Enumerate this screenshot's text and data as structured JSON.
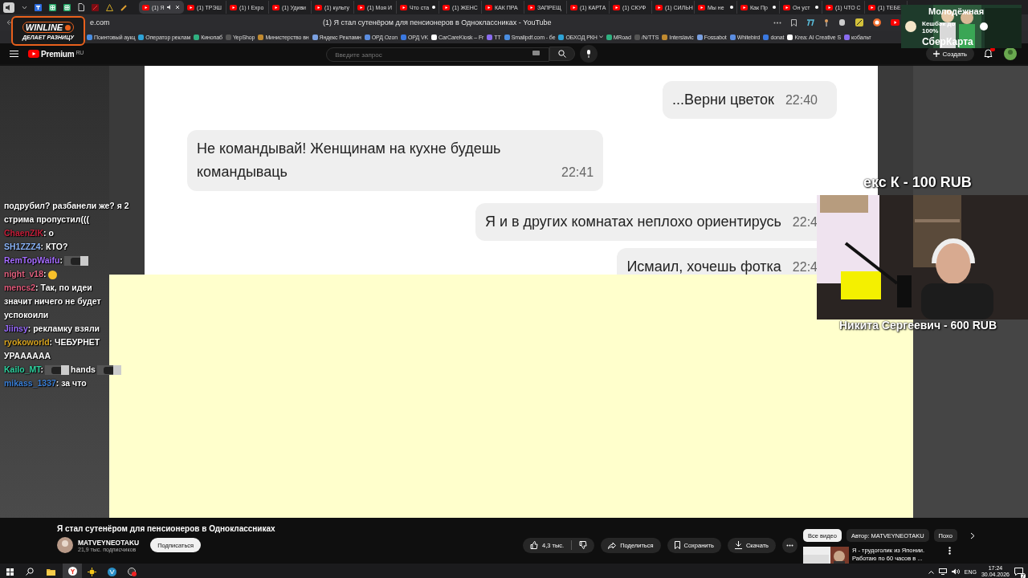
{
  "browser": {
    "tabs": [
      {
        "title": "(1) Я",
        "selected": true,
        "unread": false
      },
      {
        "title": "(1) ТРЭШ",
        "selected": false,
        "unread": false
      },
      {
        "title": "(1) I Expo",
        "selected": false,
        "unread": false
      },
      {
        "title": "(1) Удиви",
        "selected": false,
        "unread": false
      },
      {
        "title": "(1) культу",
        "selected": false,
        "unread": false
      },
      {
        "title": "(1) Моя И",
        "selected": false,
        "unread": false
      },
      {
        "title": "Что ста",
        "selected": false,
        "unread": true
      },
      {
        "title": "(1) ЖЕНС",
        "selected": false,
        "unread": false
      },
      {
        "title": "КАК ПРА",
        "selected": false,
        "unread": false
      },
      {
        "title": "ЗАПРЕЩ",
        "selected": false,
        "unread": false
      },
      {
        "title": "(1) КАРТА",
        "selected": false,
        "unread": false
      },
      {
        "title": "(1) СКУФ",
        "selected": false,
        "unread": false
      },
      {
        "title": "(1) СИЛЬН",
        "selected": false,
        "unread": false
      },
      {
        "title": "Мы не",
        "selected": false,
        "unread": true
      },
      {
        "title": "Как Пр",
        "selected": false,
        "unread": true
      },
      {
        "title": "Он уст",
        "selected": false,
        "unread": true
      },
      {
        "title": "(1) ЧТО С",
        "selected": false,
        "unread": false
      },
      {
        "title": "(1) ТЕБЕ",
        "selected": false,
        "unread": false
      }
    ],
    "address": {
      "url": "e.com",
      "page_title": "(1) Я стал сутенёром для пенсионеров в Одноклассниках - YouTube"
    },
    "bookmarks": [
      {
        "label": "Поинтовый аукц",
        "kind": "link"
      },
      {
        "label": "Оператор реклам",
        "kind": "link"
      },
      {
        "label": "Кинопаб",
        "kind": "link"
      },
      {
        "label": "YepShop",
        "kind": "link"
      },
      {
        "label": "Министерство вн",
        "kind": "link"
      },
      {
        "label": "Яндекс Рекламн",
        "kind": "link"
      },
      {
        "label": "ОРД Ozon",
        "kind": "link"
      },
      {
        "label": "ОРД VK",
        "kind": "link"
      },
      {
        "label": "CarCareKiosk – Fr",
        "kind": "link"
      },
      {
        "label": "TT",
        "kind": "link"
      },
      {
        "label": "Smallpdf.com - бе",
        "kind": "link"
      },
      {
        "label": "ОБХОД РКН",
        "kind": "folder"
      },
      {
        "label": "MRoad",
        "kind": "link"
      },
      {
        "label": "/N/TTS",
        "kind": "link"
      },
      {
        "label": "Interslavic",
        "kind": "link"
      },
      {
        "label": "Fossabot",
        "kind": "link"
      },
      {
        "label": "Whitebird",
        "kind": "link"
      },
      {
        "label": "donat",
        "kind": "link"
      },
      {
        "label": "Krea: AI Creative S",
        "kind": "link"
      },
      {
        "label": "кобальт",
        "kind": "link"
      }
    ]
  },
  "youtube_header": {
    "logo": "Premium",
    "region": "RU",
    "search_placeholder": "Введите запрос",
    "create": "Создать",
    "has_notifications": true
  },
  "chat_screenshot": {
    "messages": [
      {
        "kind": "outgoing",
        "text": "...Верни цветок",
        "time": "22:40"
      },
      {
        "kind": "incoming",
        "text": "Не командывай! Женщинам на кухне будешь командываць",
        "time": "22:41"
      },
      {
        "kind": "outgoing",
        "text": "Я и в других комнатах неплохо ориентирусь",
        "time": "22:4"
      },
      {
        "kind": "outgoing",
        "text": "Исмаил, хочешь фотка",
        "time": "22:4"
      }
    ]
  },
  "stream_chat": [
    {
      "parts": [
        {
          "kind": "text",
          "text": "подрубил? разбанели же? я 2"
        },
        {
          "kind": "break"
        },
        {
          "kind": "text",
          "text": "стрима пропустил((("
        }
      ]
    },
    {
      "user": "ChaenZIK",
      "color": "#c41e3a",
      "parts": [
        {
          "kind": "text",
          "text": ": о"
        }
      ]
    },
    {
      "user": "SH1ZZZ4",
      "color": "#8ab4f8",
      "parts": [
        {
          "kind": "text",
          "text": ": КТО?"
        }
      ]
    },
    {
      "user": "RemTopWaifu",
      "color": "#a56cff",
      "parts": [
        {
          "kind": "text",
          "text": ":"
        },
        {
          "kind": "emote"
        }
      ]
    },
    {
      "user": "night_v18",
      "color": "#e0607e",
      "parts": [
        {
          "kind": "text",
          "text": ":"
        },
        {
          "kind": "emoji"
        }
      ]
    },
    {
      "user": "mencs2",
      "color": "#e05a7a",
      "parts": [
        {
          "kind": "text",
          "text": ": Так, по идеи"
        },
        {
          "kind": "break"
        },
        {
          "kind": "text",
          "text": "значит ничего не будет"
        },
        {
          "kind": "break"
        },
        {
          "kind": "text",
          "text": "успокоили"
        }
      ]
    },
    {
      "user": "Jiinsy",
      "color": "#9b6cff",
      "parts": [
        {
          "kind": "text",
          "text": ": рекламку взяли"
        }
      ]
    },
    {
      "user": "ryokoworld",
      "color": "#d9a520",
      "parts": [
        {
          "kind": "text",
          "text": ": ЧЕБУРНЕТ"
        },
        {
          "kind": "break"
        },
        {
          "kind": "text",
          "text": "УРАААААА"
        }
      ]
    },
    {
      "user": "Kailo_MT",
      "color": "#2fd3a0",
      "parts": [
        {
          "kind": "text",
          "text": ":"
        },
        {
          "kind": "emote"
        },
        {
          "kind": "text",
          "text": "hands"
        },
        {
          "kind": "emote"
        }
      ]
    },
    {
      "user": "mikass_1337",
      "color": "#3a7fd6",
      "parts": [
        {
          "kind": "text",
          "text": ": за что"
        }
      ]
    }
  ],
  "overlays": {
    "sponsor": {
      "brand": "WINLINE",
      "slogan": "ДЕЛАЕТ РАЗНИЦУ"
    },
    "ad": {
      "headline": "Молодёжная",
      "offer": "Кешбэк до 100%",
      "product": "СберКарта"
    },
    "donations": [
      "екс К - 100 RUB",
      "Никита Сергеевич - 600 RUB"
    ]
  },
  "video": {
    "title": "Я стал сутенёром для пенсионеров в Одноклассниках",
    "channel": "MATVEYNEOTAKU",
    "subscribers": "21,9 тыс. подписчиков",
    "subscribe": "Подписаться",
    "likes": "4,3 тыс.",
    "actions": [
      {
        "kind": "share",
        "label": "Поделиться"
      },
      {
        "kind": "save",
        "label": "Сохранить"
      },
      {
        "kind": "download",
        "label": "Скачать"
      }
    ]
  },
  "recommendations": {
    "chips": [
      {
        "label": "Все видео",
        "selected": true
      },
      {
        "label": "Автор: MATVEYNEOTAKU",
        "selected": false
      },
      {
        "label": "Похо",
        "selected": false
      }
    ],
    "items": [
      {
        "title": "Я - трудоголик из Японии. Работаю по 60 часов в ..."
      }
    ]
  },
  "taskbar": {
    "language": "ENG",
    "time": "17:24",
    "date": "30.04.2026",
    "notifications": "7"
  }
}
